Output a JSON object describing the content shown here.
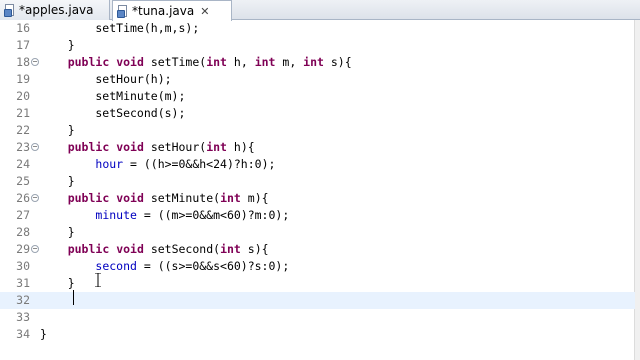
{
  "tabs": [
    {
      "label": "*apples.java",
      "active": false
    },
    {
      "label": "*tuna.java",
      "active": true
    }
  ],
  "tab_close_glyph": "✕",
  "editor": {
    "lines": [
      {
        "num": "16",
        "text": "        setTime(h,m,s);",
        "fold": false
      },
      {
        "num": "17",
        "text": "    }",
        "fold": false
      },
      {
        "num": "18",
        "text": "    public void setTime(int h, int m, int s){",
        "fold": true
      },
      {
        "num": "19",
        "text": "        setHour(h);",
        "fold": false
      },
      {
        "num": "20",
        "text": "        setMinute(m);",
        "fold": false
      },
      {
        "num": "21",
        "text": "        setSecond(s);",
        "fold": false
      },
      {
        "num": "22",
        "text": "    }",
        "fold": false
      },
      {
        "num": "23",
        "text": "    public void setHour(int h){",
        "fold": true
      },
      {
        "num": "24",
        "text": "        hour = ((h>=0&&h<24)?h:0);",
        "fold": false
      },
      {
        "num": "25",
        "text": "    }",
        "fold": false
      },
      {
        "num": "26",
        "text": "    public void setMinute(int m){",
        "fold": true
      },
      {
        "num": "27",
        "text": "        minute = ((m>=0&&m<60)?m:0);",
        "fold": false
      },
      {
        "num": "28",
        "text": "    }",
        "fold": false
      },
      {
        "num": "29",
        "text": "    public void setSecond(int s){",
        "fold": true
      },
      {
        "num": "30",
        "text": "        second = ((s>=0&&s<60)?s:0);",
        "fold": false
      },
      {
        "num": "31",
        "text": "    }",
        "fold": false
      },
      {
        "num": "32",
        "text": "",
        "fold": false,
        "current": true
      },
      {
        "num": "33",
        "text": "",
        "fold": false
      },
      {
        "num": "34",
        "text": "}",
        "fold": false
      }
    ]
  },
  "colors": {
    "keyword": "#7f0055",
    "field": "#0000c0",
    "current_line": "#e8f2fe"
  },
  "icons": [
    "java-file-icon",
    "close-icon",
    "fold-toggle-icon",
    "text-cursor-icon"
  ]
}
